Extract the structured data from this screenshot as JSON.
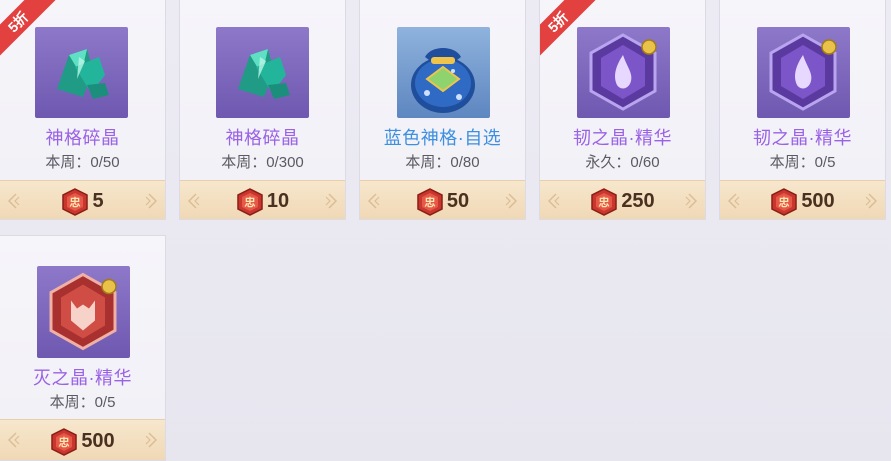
{
  "colors": {
    "name_purple": "#9a62e6",
    "name_blue": "#3d8fe0",
    "discount_red": "#e2413f",
    "price_bar": "#f0d9b7"
  },
  "items": [
    {
      "discount": "5折",
      "icon": "green-shard-icon",
      "name": "神格碎晶",
      "limit": "本周：0/50",
      "price": "5"
    },
    {
      "discount": "",
      "icon": "green-shard-icon",
      "name": "神格碎晶",
      "limit": "本周：0/300",
      "price": "10"
    },
    {
      "discount": "",
      "icon": "blue-bag-icon",
      "name": "蓝色神格·自选",
      "limit": "本周：0/80",
      "price": "50"
    },
    {
      "discount": "5折",
      "icon": "purple-crystal-icon",
      "name": "韧之晶·精华",
      "limit": "永久：0/60",
      "price": "250"
    },
    {
      "discount": "",
      "icon": "purple-crystal-icon",
      "name": "韧之晶·精华",
      "limit": "本周：0/5",
      "price": "500"
    },
    {
      "discount": "",
      "icon": "red-crystal-icon",
      "name": "灭之晶·精华",
      "limit": "本周：0/5",
      "price": "500"
    }
  ]
}
